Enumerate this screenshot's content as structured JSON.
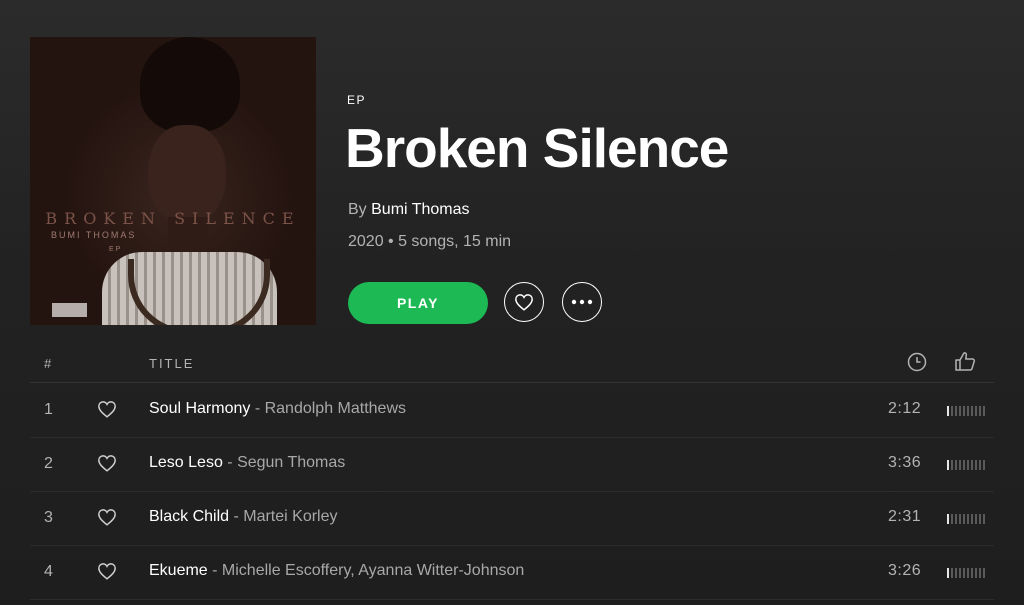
{
  "album": {
    "type_label": "EP",
    "title": "Broken Silence",
    "by_prefix": "By",
    "artist": "Bumi Thomas",
    "meta": "2020 • 5 songs, 15 min",
    "cover": {
      "title_text": "BROKEN SILENCE",
      "artist_text": "BUMI THOMAS",
      "ep_text": "EP"
    }
  },
  "actions": {
    "play_label": "PLAY",
    "like_icon": "heart-icon",
    "more_icon": "more-horizontal-icon"
  },
  "tracklist": {
    "header": {
      "number": "#",
      "title": "TITLE",
      "duration_icon": "clock-icon",
      "popularity_icon": "thumbs-up-icon"
    },
    "tracks": [
      {
        "number": "1",
        "name": "Soul Harmony",
        "separator": " - ",
        "artists": "Randolph Matthews",
        "duration": "2:12",
        "popularity": 0.1
      },
      {
        "number": "2",
        "name": "Leso Leso",
        "separator": " - ",
        "artists": "Segun Thomas",
        "duration": "3:36",
        "popularity": 0.1
      },
      {
        "number": "3",
        "name": "Black Child",
        "separator": " - ",
        "artists": "Martei Korley",
        "duration": "2:31",
        "popularity": 0.1
      },
      {
        "number": "4",
        "name": "Ekueme",
        "separator": " - ",
        "artists": "Michelle Escoffery, Ayanna Witter-Johnson",
        "duration": "3:26",
        "popularity": 0.1
      }
    ]
  },
  "colors": {
    "accent": "#1db954",
    "text_primary": "#ffffff",
    "text_secondary": "#b3b3b3",
    "background": "#181818"
  }
}
